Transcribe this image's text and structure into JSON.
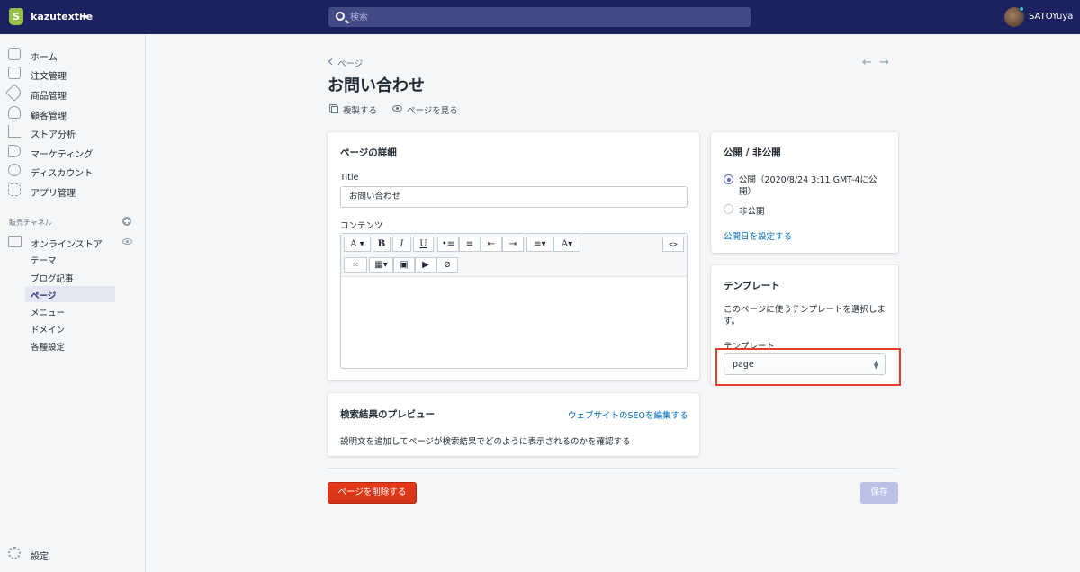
{
  "topbar": {
    "store_name": "kazutextile",
    "search_placeholder": "検索",
    "user_name": "SATOYuya"
  },
  "sidebar": {
    "items": [
      {
        "label": "ホーム",
        "icon": "home-icon"
      },
      {
        "label": "注文管理",
        "icon": "orders-icon"
      },
      {
        "label": "商品管理",
        "icon": "tag-icon"
      },
      {
        "label": "顧客管理",
        "icon": "person-icon"
      },
      {
        "label": "ストア分析",
        "icon": "chart-icon"
      },
      {
        "label": "マーケティング",
        "icon": "megaphone-icon"
      },
      {
        "label": "ディスカウント",
        "icon": "discount-icon"
      },
      {
        "label": "アプリ管理",
        "icon": "apps-icon"
      }
    ],
    "sales_channels_title": "販売チャネル",
    "online_store": "オンラインストア",
    "sub_items": [
      "テーマ",
      "ブログ記事",
      "ページ",
      "メニュー",
      "ドメイン",
      "各種設定"
    ],
    "active_sub_index": 2,
    "settings": "設定"
  },
  "main": {
    "breadcrumb": "ページ",
    "title": "お問い合わせ",
    "duplicate": "複製する",
    "view_page": "ページを見る"
  },
  "details_card": {
    "title": "ページの詳細",
    "title_label": "Title",
    "title_value": "お問い合わせ",
    "content_label": "コンテンツ"
  },
  "seo_card": {
    "title": "検索結果のプレビュー",
    "edit_link": "ウェブサイトのSEOを編集する",
    "description": "説明文を追加してページが検索結果でどのように表示されるのかを確認する"
  },
  "visibility_card": {
    "title": "公開 / 非公開",
    "option_public_line1": "公開（2020/8/24 3:11 GMT-4に公",
    "option_public_line2": "開）",
    "option_hidden": "非公開",
    "set_date_link": "公開日を設定する",
    "selected": "public"
  },
  "template_card": {
    "title": "テンプレート",
    "description_line1": "このページに使うテンプレートを選択しま",
    "description_line2": "す。",
    "select_label": "テンプレート",
    "select_value": "page"
  },
  "footer": {
    "delete": "ページを削除する",
    "save": "保存"
  },
  "colors": {
    "topbar": "#1c2260",
    "accent": "#5c6ac4",
    "danger": "#de3618",
    "highlight": "#e53e2b"
  }
}
